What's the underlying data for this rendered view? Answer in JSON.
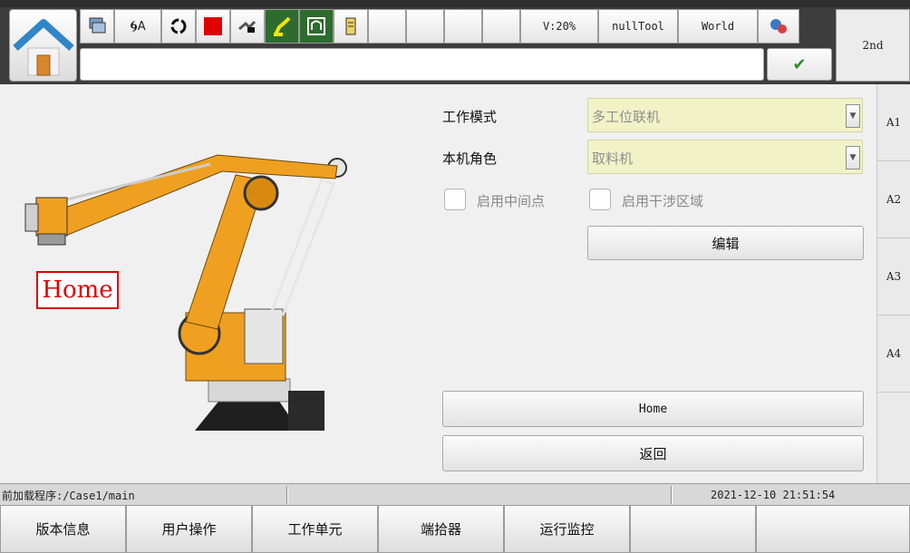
{
  "toolbar": {
    "velocity": "V:20%",
    "tool": "nullTool",
    "frame": "World",
    "mode_letter": "A",
    "second_label": "2nd"
  },
  "message_field": {
    "value": ""
  },
  "side_tabs": [
    "A1",
    "A2",
    "A3",
    "A4"
  ],
  "form": {
    "work_mode_label": "工作模式",
    "work_mode_value": "多工位联机",
    "role_label": "本机角色",
    "role_value": "取料机",
    "enable_midpoint_label": "启用中间点",
    "enable_midpoint_checked": false,
    "enable_interference_label": "启用干涉区域",
    "enable_interference_checked": false,
    "edit_button": "编辑"
  },
  "robot_view": {
    "position_label": "Home"
  },
  "actions": {
    "home_button": "Home",
    "back_button": "返回"
  },
  "status": {
    "program": "前加载程序:/Case1/main",
    "datetime": "2021-12-10 21:51:54"
  },
  "bottom_nav": [
    "版本信息",
    "用户操作",
    "工作单元",
    "端拾器",
    "运行监控",
    "",
    ""
  ],
  "colors": {
    "accent_active": "#2e6b2e",
    "select_bg": "#f1f3c7",
    "robot_orange": "#f0a020",
    "home_label_red": "#e00000"
  }
}
